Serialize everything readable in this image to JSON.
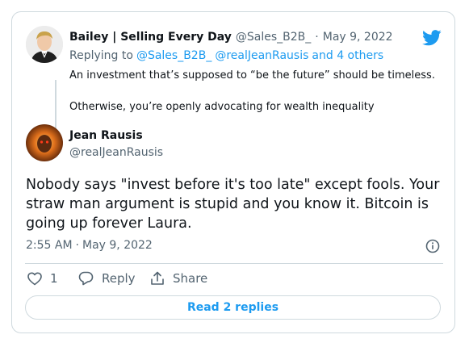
{
  "reply_tweet": {
    "author_name": "Bailey | Selling Every Day",
    "author_handle": "@Sales_B2B_",
    "separator": "·",
    "date": "May 9, 2022",
    "replying_prefix": "Replying to",
    "replying_handle_1": "@Sales_B2B_",
    "replying_handle_2": "@realJeanRausis",
    "replying_others": "and 4 others",
    "line_1": "An investment that’s supposed to “be the future” should be timeless.",
    "line_2": "Otherwise, you’re openly advocating for wealth inequality"
  },
  "main_tweet": {
    "author_name": "Jean Rausis",
    "author_handle": "@realJeanRausis",
    "text": "Nobody says \"invest before it's too late\" except fools. Your straw man argument is stupid and you know it. Bitcoin is going up forever Laura.",
    "time": "2:55 AM",
    "separator": "·",
    "date": "May 9, 2022"
  },
  "actions": {
    "like_count": "1",
    "reply_label": "Reply",
    "share_label": "Share"
  },
  "read_replies_label": "Read 2 replies",
  "icons": {
    "brand": "twitter-bird-icon",
    "info": "info-icon",
    "like": "heart-icon",
    "reply": "reply-bubble-icon",
    "share": "share-icon"
  },
  "colors": {
    "accent": "#1d9bf0",
    "text": "#0f1419",
    "muted": "#536471",
    "border": "#cfd9de"
  }
}
